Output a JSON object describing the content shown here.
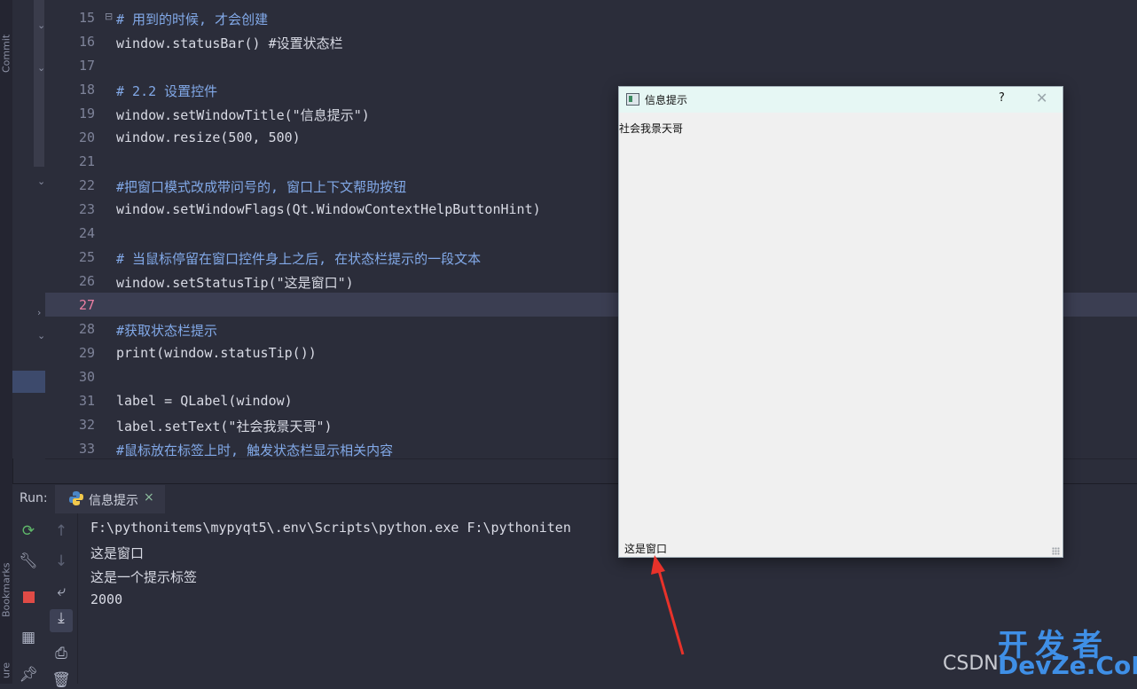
{
  "left_strip": {
    "tabs": [
      "Commit",
      "Bookmarks",
      "ure"
    ]
  },
  "editor": {
    "lines": [
      {
        "n": "15",
        "t": "# 用到的时候, 才会创建"
      },
      {
        "n": "16",
        "t": "window.statusBar() #设置状态栏"
      },
      {
        "n": "17",
        "t": ""
      },
      {
        "n": "18",
        "t": "# 2.2 设置控件"
      },
      {
        "n": "19",
        "t": "window.setWindowTitle(\"信息提示\")"
      },
      {
        "n": "20",
        "t": "window.resize(500, 500)"
      },
      {
        "n": "21",
        "t": ""
      },
      {
        "n": "22",
        "t": "#把窗口模式改成带问号的, 窗口上下文帮助按钮"
      },
      {
        "n": "23",
        "t": "window.setWindowFlags(Qt.WindowContextHelpButtonHint)"
      },
      {
        "n": "24",
        "t": ""
      },
      {
        "n": "25",
        "t": "# 当鼠标停留在窗口控件身上之后, 在状态栏提示的一段文本"
      },
      {
        "n": "26",
        "t": "window.setStatusTip(\"这是窗口\")"
      },
      {
        "n": "27",
        "t": ""
      },
      {
        "n": "28",
        "t": "#获取状态栏提示"
      },
      {
        "n": "29",
        "t": "print(window.statusTip())"
      },
      {
        "n": "30",
        "t": ""
      },
      {
        "n": "31",
        "t": "label = QLabel(window)"
      },
      {
        "n": "32",
        "t": "label.setText(\"社会我景天哥\")"
      },
      {
        "n": "33",
        "t": "#鼠标放在标签上时, 触发状态栏显示相关内容"
      }
    ],
    "current_line": "27"
  },
  "run_panel": {
    "title": "Run:",
    "tab_label": "信息提示",
    "tab_close": "×",
    "output": [
      "F:\\pythonitems\\mypyqt5\\.env\\Scripts\\python.exe F:\\pythoniten",
      "这是窗口",
      "这是一个提示标签",
      "2000"
    ]
  },
  "qt_window": {
    "title": "信息提示",
    "help_button": "?",
    "close_button": "✕",
    "label_text": "社会我景天哥",
    "status_text": "这是窗口"
  },
  "watermark": {
    "csdn": "CSDN",
    "dev_line1": "开发者",
    "dev_line2": "DevZe.CoM"
  },
  "colors": {
    "editor_bg": "#2b2d3a",
    "comment": "#82a9e8",
    "function": "#82dcc7",
    "string": "#f0d987",
    "number": "#c79df0",
    "keyword": "#ee95d0",
    "arrow": "#e8322a",
    "watermark": "#3f8fe6"
  }
}
